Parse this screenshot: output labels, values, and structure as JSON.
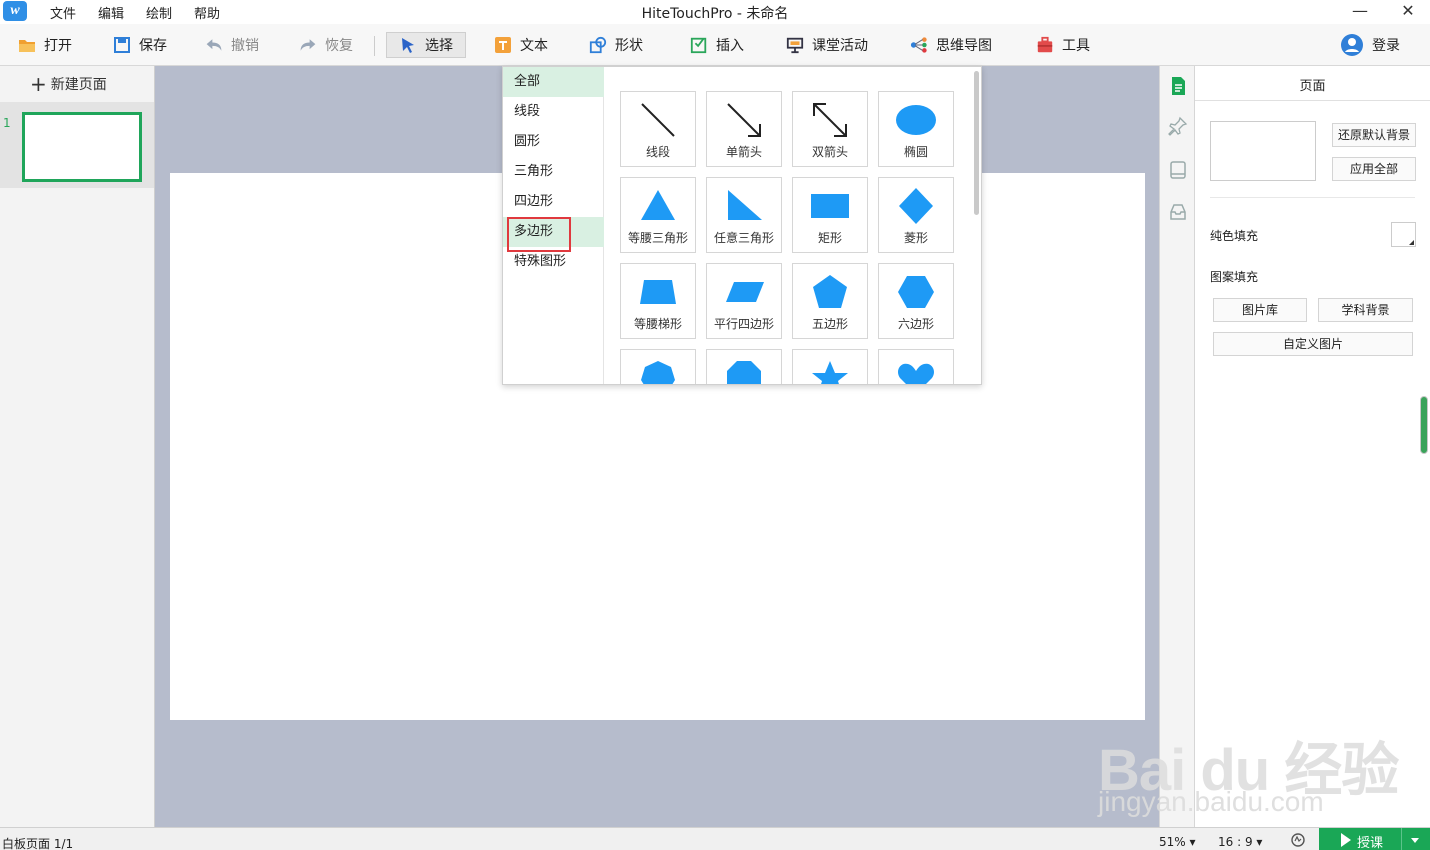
{
  "app": {
    "title": "HiteTouchPro - 未命名",
    "menu": [
      "文件",
      "编辑",
      "绘制",
      "帮助"
    ],
    "minimize": "—",
    "close": "✕"
  },
  "toolbar": {
    "open": "打开",
    "save": "保存",
    "undo": "撤销",
    "redo": "恢复",
    "select": "选择",
    "text": "文本",
    "shape": "形状",
    "insert": "插入",
    "class_activity": "课堂活动",
    "mindmap": "思维导图",
    "tools": "工具",
    "login": "登录"
  },
  "left_panel": {
    "new_page": "新建页面",
    "slide_number": "1"
  },
  "shapes_popup": {
    "categories": [
      "全部",
      "线段",
      "圆形",
      "三角形",
      "四边形",
      "多边形",
      "特殊图形"
    ],
    "selected_category": "全部",
    "highlighted_category": "多边形",
    "shapes": [
      "线段",
      "单箭头",
      "双箭头",
      "椭圆",
      "等腰三角形",
      "任意三角形",
      "矩形",
      "菱形",
      "等腰梯形",
      "平行四边形",
      "五边形",
      "六边形"
    ],
    "shape_color": "#1e9af5"
  },
  "right_panel": {
    "title": "页面",
    "restore_bg": "还原默认背景",
    "apply_all": "应用全部",
    "solid_fill": "纯色填充",
    "pattern_fill": "图案填充",
    "gallery": "图片库",
    "subject_bg": "学科背景",
    "custom_image": "自定义图片"
  },
  "statusbar": {
    "page_info": "白板页面 1/1",
    "zoom": "51%",
    "ratio": "16 : 9",
    "teach": "授课"
  },
  "watermark": {
    "brand": "Bai du 经验",
    "url": "jingyan.baidu.com"
  },
  "colors": {
    "accent_green": "#1aa756",
    "canvas_bg": "#b6bccc",
    "shape_blue": "#1e9af5",
    "highlight_red": "#e0393e"
  }
}
